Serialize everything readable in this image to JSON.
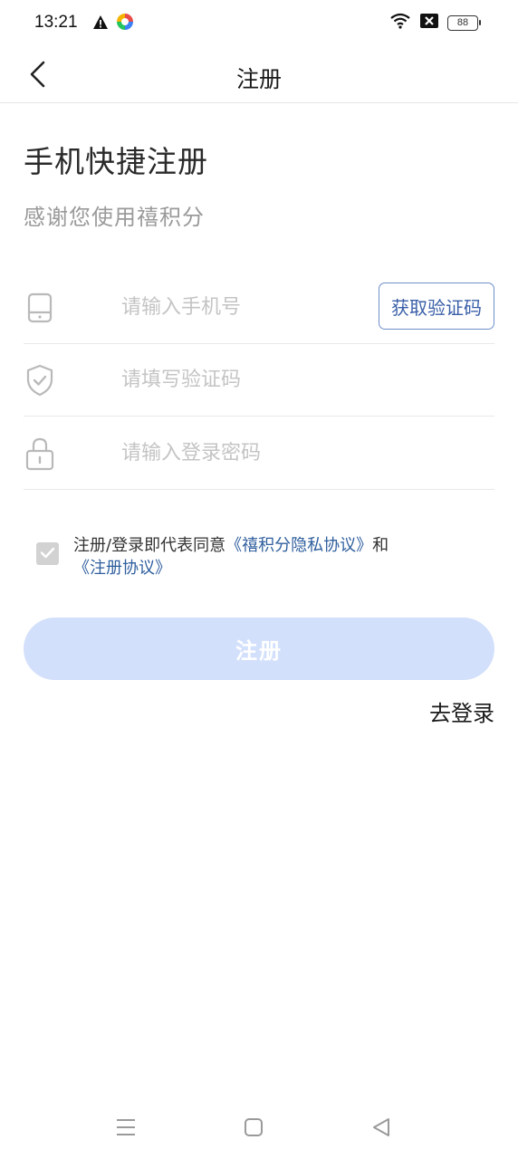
{
  "status_bar": {
    "time": "13:21",
    "battery": "88",
    "icons": [
      "warning-icon",
      "app-icon",
      "wifi-icon",
      "sim-off-icon",
      "battery-icon"
    ]
  },
  "nav": {
    "title": "注册",
    "back_icon": "chevron-left-icon"
  },
  "header": {
    "title": "手机快捷注册",
    "subtitle": "感谢您使用禧积分"
  },
  "form": {
    "phone_placeholder": "请输入手机号",
    "code_placeholder": "请填写验证码",
    "password_placeholder": "请输入登录密码",
    "get_code_label": "获取验证码",
    "icons": [
      "phone-icon",
      "shield-icon",
      "lock-icon"
    ]
  },
  "agreement": {
    "checked": true,
    "prefix": "注册/登录即代表同意",
    "privacy_link": "《禧积分隐私协议》",
    "joiner": "和",
    "register_link": "《注册协议》"
  },
  "actions": {
    "submit_label": "注册",
    "login_link": "去登录"
  },
  "colors": {
    "accent": "#2f5f9e",
    "button_disabled": "#d3e0fb",
    "border_blue": "#6f8fc9",
    "placeholder": "#c4c4c4"
  },
  "system_nav": [
    "menu-icon",
    "home-icon",
    "back-icon"
  ]
}
